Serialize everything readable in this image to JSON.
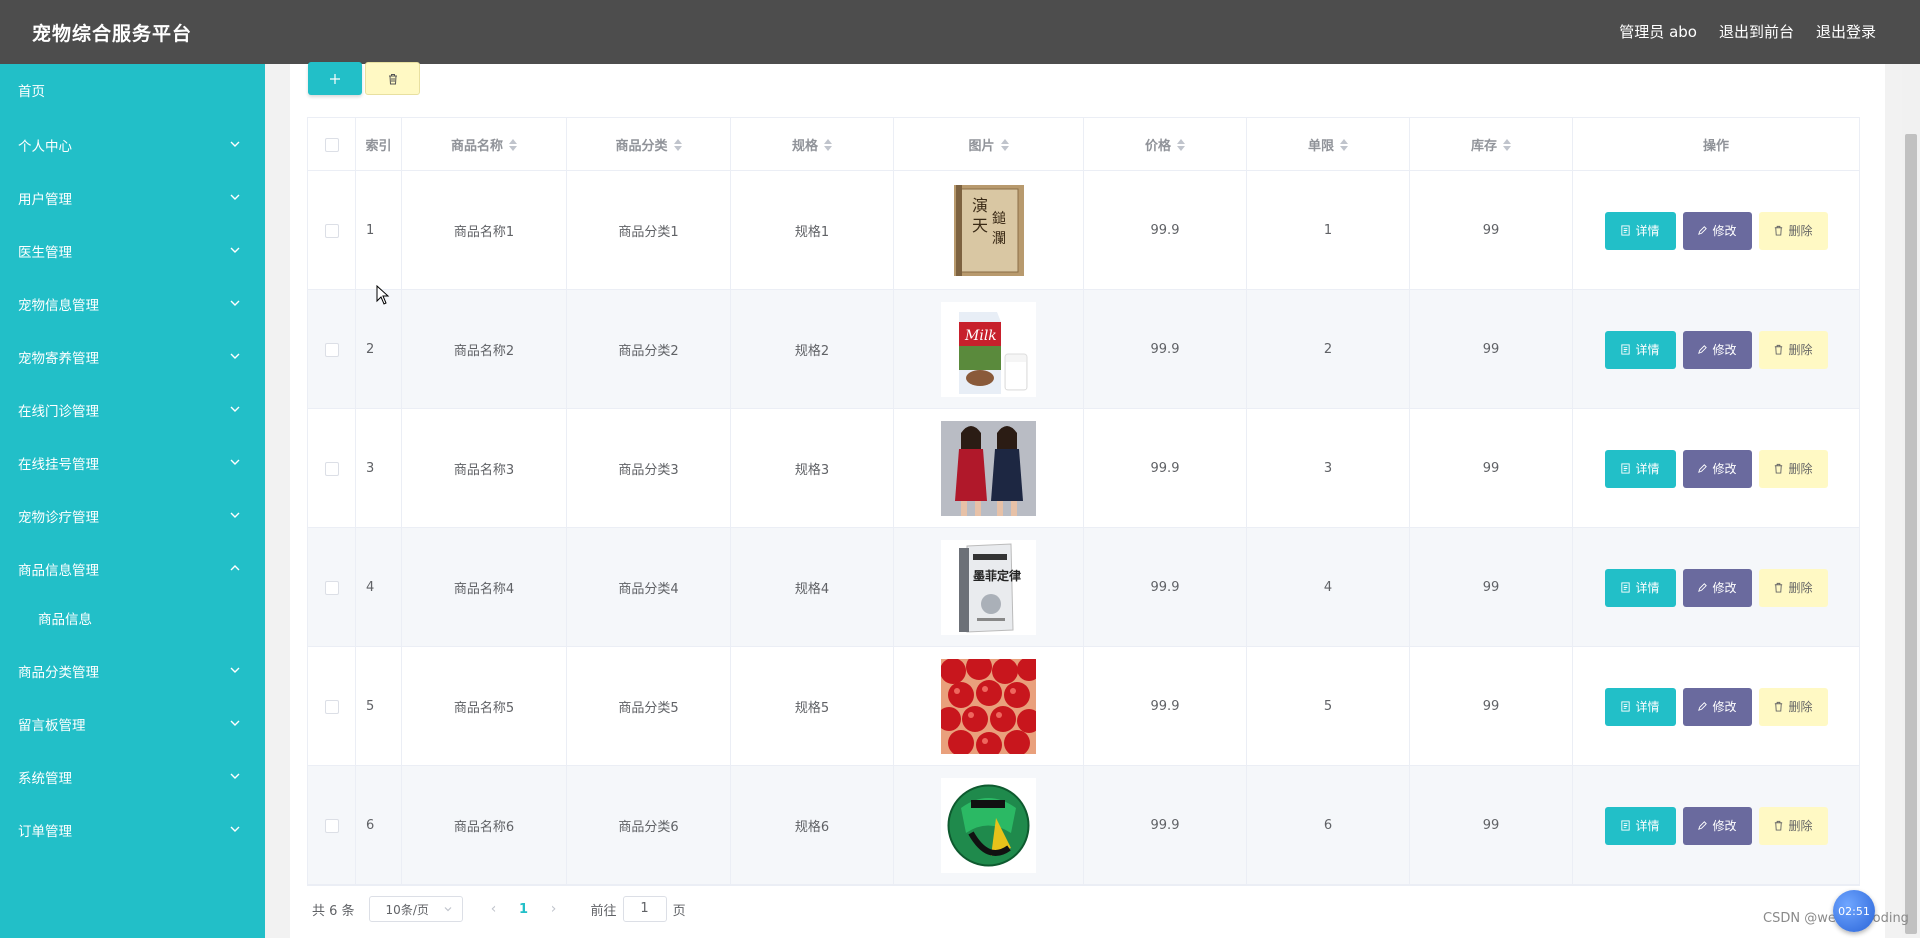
{
  "header": {
    "title": "宠物综合服务平台",
    "nav": [
      "管理员 abo",
      "退出到前台",
      "退出登录"
    ]
  },
  "sidebar": {
    "items": [
      {
        "label": "首页",
        "has_children": false
      },
      {
        "label": "个人中心",
        "has_children": true
      },
      {
        "label": "用户管理",
        "has_children": true
      },
      {
        "label": "医生管理",
        "has_children": true
      },
      {
        "label": "宠物信息管理",
        "has_children": true
      },
      {
        "label": "宠物寄养管理",
        "has_children": true
      },
      {
        "label": "在线门诊管理",
        "has_children": true
      },
      {
        "label": "在线挂号管理",
        "has_children": true
      },
      {
        "label": "宠物诊疗管理",
        "has_children": true
      },
      {
        "label": "商品信息管理",
        "has_children": true,
        "expanded": true
      },
      {
        "label": "商品信息",
        "sub": true
      },
      {
        "label": "商品分类管理",
        "has_children": true
      },
      {
        "label": "留言板管理",
        "has_children": true
      },
      {
        "label": "系统管理",
        "has_children": true
      },
      {
        "label": "订单管理",
        "has_children": true
      }
    ]
  },
  "toolbar": {
    "add_icon": "plus-icon",
    "delete_icon": "trash-icon"
  },
  "table": {
    "columns": [
      "索引",
      "商品名称",
      "商品分类",
      "规格",
      "图片",
      "价格",
      "单限",
      "库存",
      "操作"
    ],
    "rows": [
      {
        "index": "1",
        "name": "商品名称1",
        "category": "商品分类1",
        "spec": "规格1",
        "image": "book-cover",
        "price": "99.9",
        "limit": "1",
        "stock": "99"
      },
      {
        "index": "2",
        "name": "商品名称2",
        "category": "商品分类2",
        "spec": "规格2",
        "image": "milk-carton",
        "price": "99.9",
        "limit": "2",
        "stock": "99"
      },
      {
        "index": "3",
        "name": "商品名称3",
        "category": "商品分类3",
        "spec": "规格3",
        "image": "dresses-photo",
        "price": "99.9",
        "limit": "3",
        "stock": "99"
      },
      {
        "index": "4",
        "name": "商品名称4",
        "category": "商品分类4",
        "spec": "规格4",
        "image": "book-cover-white",
        "price": "99.9",
        "limit": "4",
        "stock": "99"
      },
      {
        "index": "5",
        "name": "商品名称5",
        "category": "商品分类5",
        "spec": "规格5",
        "image": "cherries-photo",
        "price": "99.9",
        "limit": "5",
        "stock": "99"
      },
      {
        "index": "6",
        "name": "商品名称6",
        "category": "商品分类6",
        "spec": "规格6",
        "image": "football-photo",
        "price": "99.9",
        "limit": "6",
        "stock": "99"
      }
    ],
    "actions": {
      "detail": "详情",
      "edit": "修改",
      "delete": "删除"
    }
  },
  "pagination": {
    "total": "共 6 条",
    "page_size": "10条/页",
    "current_page": "1",
    "goto_label": "前往",
    "goto_value": "1",
    "goto_suffix": "页"
  },
  "watermark": "CSDN @weixin_coding",
  "clock": "02:51",
  "colors": {
    "accent": "#22bfc8",
    "header": "#4d4d4d",
    "edit": "#6a6a9e",
    "delete": "#fff9c4"
  }
}
